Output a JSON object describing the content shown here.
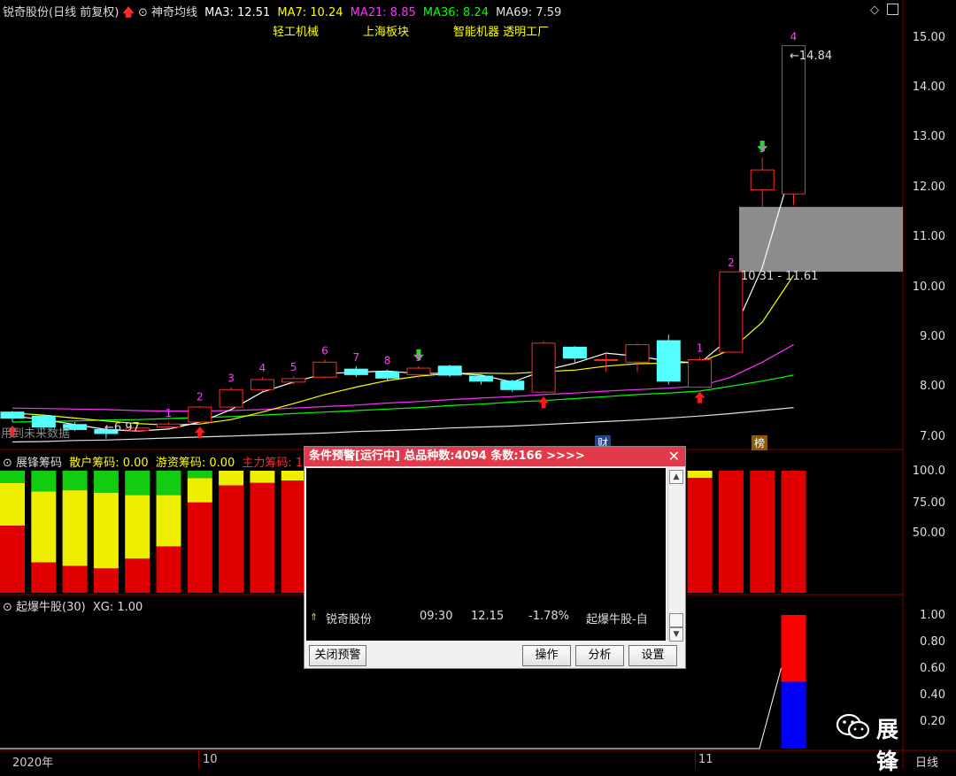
{
  "header": {
    "stock_title": "锐奇股份(日线 前复权)",
    "indicator_name": "神奇均线",
    "ma3": "MA3: 12.51",
    "ma7": "MA7: 10.24",
    "ma21": "MA21: 8.85",
    "ma36": "MA36: 8.24",
    "ma69": "MA69: 7.59"
  },
  "concepts": [
    "轻工机械",
    "上海板块",
    "智能机器 透明工厂"
  ],
  "price_axis": [
    "15.00",
    "14.00",
    "13.00",
    "12.00",
    "11.00",
    "10.00",
    "9.00",
    "8.00",
    "7.00"
  ],
  "annotations": {
    "high_price": "14.84",
    "low_price": "6.97",
    "zone_range": "10.31 - 11.61",
    "future_data": "用到未来数据",
    "badge_cai": "财",
    "badge_bang": "榜",
    "counts": [
      "1",
      "2",
      "3",
      "4",
      "5",
      "6",
      "7",
      "8",
      "9",
      "1",
      "2",
      "3",
      "4"
    ]
  },
  "panel2": {
    "name": "展锋筹码",
    "retail": "散户筹码: 0.00",
    "hot": "游资筹码: 0.00",
    "main": "主力筹码: 1",
    "axis": [
      "100.0",
      "75.00",
      "50.00"
    ]
  },
  "panel3": {
    "name": "起爆牛股(30)",
    "xg": "XG: 1.00",
    "axis": [
      "1.00",
      "0.80",
      "0.60",
      "0.40",
      "0.20"
    ]
  },
  "time_axis": {
    "year": "2020年",
    "m10": "10",
    "m11": "11",
    "period": "日线"
  },
  "alert_dialog": {
    "title": "条件预警[运行中] 总品种数:4094 条数:166 >>>>",
    "close": "✕",
    "row": {
      "name": "锐奇股份",
      "time": "09:30",
      "price": "12.15",
      "change": "-1.78%",
      "condition": "起爆牛股-自"
    },
    "btn_close_alert": "关闭预警",
    "btn_operate": "操作",
    "btn_analyze": "分析",
    "btn_settings": "设置"
  },
  "watermark": "展锋",
  "colors": {
    "up": "#ff2a2a",
    "down": "#54ffff",
    "ma3": "#ffffff",
    "ma7": "#ffff00",
    "ma21": "#ff30ff",
    "ma36": "#00ff00",
    "ma69": "#e0e0e0",
    "dialog_title": "#e23a4a"
  },
  "chart_data": {
    "type": "candlestick",
    "y_range": [
      6.75,
      15.4
    ],
    "candles": [
      {
        "o": 7.5,
        "c": 7.38,
        "h": 7.52,
        "l": 7.3
      },
      {
        "o": 7.42,
        "c": 7.2,
        "h": 7.45,
        "l": 7.16
      },
      {
        "o": 7.25,
        "c": 7.15,
        "h": 7.3,
        "l": 7.12
      },
      {
        "o": 7.15,
        "c": 7.07,
        "h": 7.18,
        "l": 6.97
      },
      {
        "o": 7.13,
        "c": 7.18,
        "h": 7.24,
        "l": 7.1
      },
      {
        "o": 7.2,
        "c": 7.26,
        "h": 7.3,
        "l": 7.17
      },
      {
        "o": 7.3,
        "c": 7.6,
        "h": 7.63,
        "l": 7.28
      },
      {
        "o": 7.6,
        "c": 7.95,
        "h": 8.0,
        "l": 7.58
      },
      {
        "o": 7.95,
        "c": 8.15,
        "h": 8.2,
        "l": 7.92
      },
      {
        "o": 8.1,
        "c": 8.17,
        "h": 8.22,
        "l": 8.05
      },
      {
        "o": 8.2,
        "c": 8.5,
        "h": 8.55,
        "l": 8.18
      },
      {
        "o": 8.36,
        "c": 8.25,
        "h": 8.42,
        "l": 8.2
      },
      {
        "o": 8.3,
        "c": 8.18,
        "h": 8.35,
        "l": 8.12
      },
      {
        "o": 8.25,
        "c": 8.38,
        "h": 8.42,
        "l": 8.18
      },
      {
        "o": 8.42,
        "c": 8.24,
        "h": 8.45,
        "l": 8.2
      },
      {
        "o": 8.22,
        "c": 8.12,
        "h": 8.25,
        "l": 8.05
      },
      {
        "o": 8.12,
        "c": 7.95,
        "h": 8.15,
        "l": 7.9
      },
      {
        "o": 7.9,
        "c": 8.88,
        "h": 8.92,
        "l": 7.88
      },
      {
        "o": 8.8,
        "c": 8.58,
        "h": 8.82,
        "l": 8.5
      },
      {
        "o": 8.55,
        "c": 8.55,
        "h": 8.68,
        "l": 8.3
      },
      {
        "o": 8.5,
        "c": 8.85,
        "h": 8.88,
        "l": 8.3
      },
      {
        "o": 8.93,
        "c": 8.12,
        "h": 9.05,
        "l": 8.05
      },
      {
        "o": 8.0,
        "c": 8.55,
        "h": 8.6,
        "l": 7.98
      },
      {
        "o": 8.7,
        "c": 10.31,
        "h": 10.31,
        "l": 8.7
      },
      {
        "o": 11.95,
        "c": 12.35,
        "h": 12.6,
        "l": 11.6
      },
      {
        "o": 11.87,
        "c": 14.84,
        "h": 14.84,
        "l": 11.65
      }
    ],
    "ma3": [
      7.42,
      7.35,
      7.25,
      7.15,
      7.12,
      7.16,
      7.3,
      7.55,
      7.9,
      8.1,
      8.27,
      8.3,
      8.32,
      8.27,
      8.28,
      8.24,
      8.1,
      8.33,
      8.48,
      8.68,
      8.62,
      8.52,
      8.48,
      9.0,
      10.4,
      12.51
    ],
    "ma7": [
      7.48,
      7.44,
      7.38,
      7.32,
      7.27,
      7.24,
      7.26,
      7.35,
      7.5,
      7.67,
      7.85,
      8.0,
      8.13,
      8.22,
      8.27,
      8.28,
      8.27,
      8.31,
      8.34,
      8.42,
      8.47,
      8.48,
      8.5,
      8.75,
      9.3,
      10.24
    ],
    "ma21": [
      7.58,
      7.57,
      7.56,
      7.55,
      7.53,
      7.52,
      7.52,
      7.53,
      7.55,
      7.58,
      7.61,
      7.64,
      7.68,
      7.71,
      7.75,
      7.78,
      7.81,
      7.85,
      7.88,
      7.92,
      7.95,
      7.98,
      8.02,
      8.2,
      8.5,
      8.85
    ],
    "ma36": [
      7.3,
      7.31,
      7.32,
      7.34,
      7.35,
      7.37,
      7.39,
      7.41,
      7.44,
      7.47,
      7.5,
      7.53,
      7.56,
      7.59,
      7.63,
      7.66,
      7.7,
      7.73,
      7.77,
      7.81,
      7.85,
      7.88,
      7.92,
      8.02,
      8.12,
      8.24
    ],
    "ma69": [
      6.9,
      6.91,
      6.93,
      6.94,
      6.96,
      6.98,
      7.0,
      7.02,
      7.04,
      7.06,
      7.08,
      7.11,
      7.13,
      7.15,
      7.18,
      7.2,
      7.22,
      7.25,
      7.28,
      7.31,
      7.34,
      7.38,
      7.42,
      7.47,
      7.53,
      7.59
    ],
    "up_arrows": [
      0,
      6,
      17,
      22
    ],
    "down_arrows": [
      13,
      24
    ],
    "count_labels": [
      {
        "i": 5,
        "n": "1"
      },
      {
        "i": 6,
        "n": "2"
      },
      {
        "i": 7,
        "n": "3"
      },
      {
        "i": 8,
        "n": "4"
      },
      {
        "i": 9,
        "n": "5"
      },
      {
        "i": 10,
        "n": "6"
      },
      {
        "i": 11,
        "n": "7"
      },
      {
        "i": 12,
        "n": "8"
      },
      {
        "i": 13,
        "n": "9"
      },
      {
        "i": 22,
        "n": "1"
      },
      {
        "i": 23,
        "n": "2"
      },
      {
        "i": 24,
        "n": "3"
      },
      {
        "i": 25,
        "n": "4"
      }
    ],
    "chips_red": [
      55,
      25,
      22,
      20,
      28,
      38,
      74,
      88,
      90,
      92,
      100,
      100,
      100,
      100,
      100,
      100,
      100,
      100,
      100,
      100,
      100,
      92,
      94,
      100,
      100,
      100
    ],
    "chips_yellow": [
      35,
      58,
      62,
      62,
      52,
      42,
      20,
      12,
      10,
      8,
      0,
      0,
      0,
      0,
      0,
      0,
      0,
      0,
      0,
      0,
      0,
      8,
      6,
      0,
      0,
      0
    ],
    "xg_red": 0.5,
    "xg_blue": 0.5
  }
}
